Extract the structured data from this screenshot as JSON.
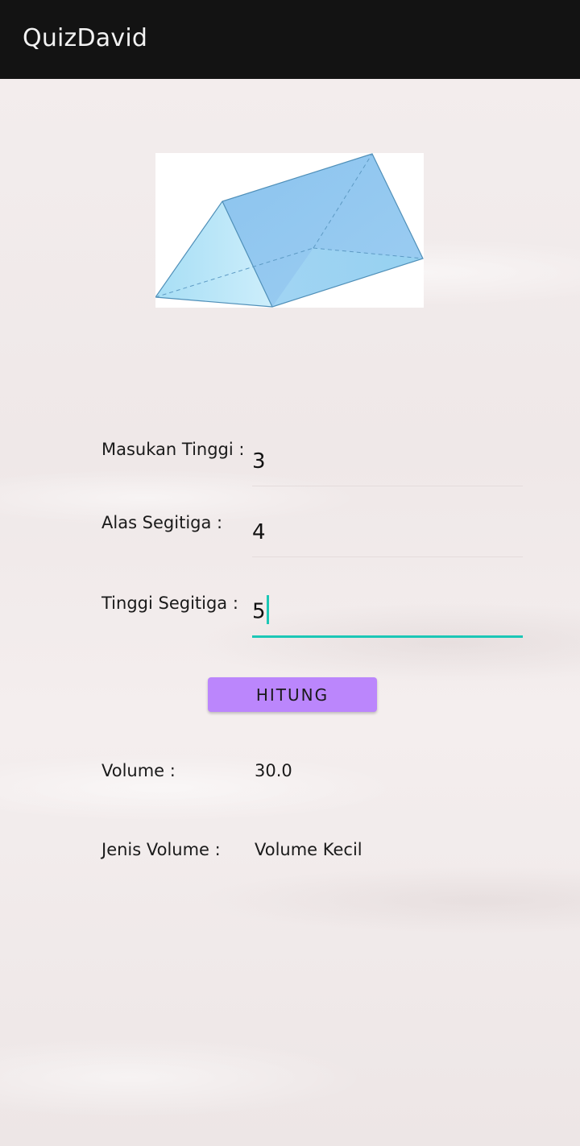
{
  "app": {
    "title": "QuizDavid"
  },
  "form": {
    "tinggi": {
      "label": "Masukan Tinggi :",
      "value": "3"
    },
    "alas": {
      "label": "Alas Segitiga :",
      "value": "4"
    },
    "tinggi_segitiga": {
      "label": "Tinggi Segitiga :",
      "value": "5"
    }
  },
  "button": {
    "label": "HITUNG"
  },
  "results": {
    "volume": {
      "label": "Volume :",
      "value": "30.0"
    },
    "jenis": {
      "label": "Jenis Volume :",
      "value": "Volume Kecil"
    }
  },
  "colors": {
    "appbar": "#131313",
    "accent": "#1cc7b6",
    "button": "#bb86fc",
    "prism_face": "#8ec5ef"
  },
  "icons": {
    "image": "triangular-prism-image"
  }
}
